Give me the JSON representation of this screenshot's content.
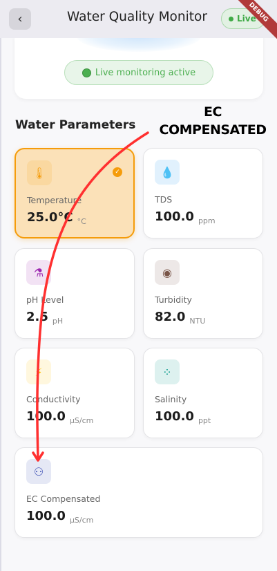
{
  "header": {
    "title": "Water Quality Monitor",
    "live_badge": "Live",
    "back_icon": "chevron-left-icon",
    "debug_banner": "DEBUG"
  },
  "status_card": {
    "pill": "Live monitoring active"
  },
  "section_title": "Water Parameters",
  "annotation": {
    "line1": "EC",
    "line2": "COMPENSATED",
    "color": "#ff3030"
  },
  "parameters": [
    {
      "label": "Temperature",
      "value": "25.0°C",
      "unit": "°C",
      "icon": "thermometer-icon",
      "color": "#f59c0b",
      "selected": true
    },
    {
      "label": "TDS",
      "value": "100.0",
      "unit": "ppm",
      "icon": "water-drop-icon",
      "color": "#2196f3"
    },
    {
      "label": "pH Level",
      "value": "2.5",
      "unit": "pH",
      "icon": "flask-icon",
      "color": "#9c27b0"
    },
    {
      "label": "Turbidity",
      "value": "82.0",
      "unit": "NTU",
      "icon": "eye-icon",
      "color": "#795548"
    },
    {
      "label": "Conductivity",
      "value": "100.0",
      "unit": "µS/cm",
      "icon": "bolt-icon",
      "color": "#ffc107"
    },
    {
      "label": "Salinity",
      "value": "100.0",
      "unit": "ppt",
      "icon": "grain-icon",
      "color": "#009688"
    },
    {
      "label": "EC Compensated",
      "value": "100.0",
      "unit": "µS/cm",
      "icon": "plug-icon",
      "color": "#3f51b5"
    }
  ]
}
